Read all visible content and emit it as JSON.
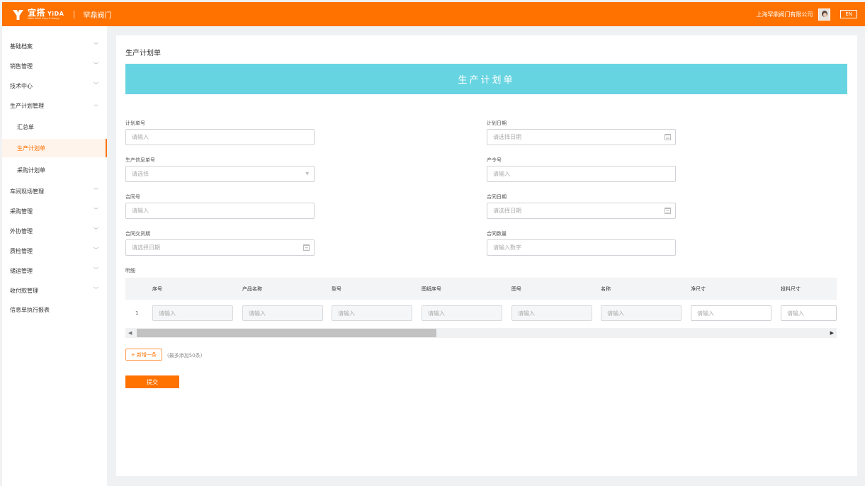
{
  "header": {
    "logo_text": "宜搭",
    "logo_en": "YiDA",
    "logo_tagline": "Make Work Easy & Happy",
    "org_name": "罕鼎阀门",
    "company": "上海罕鼎阀门有限公司",
    "lang_button": "EN"
  },
  "colors": {
    "brand": "#ff7200",
    "banner": "#67d4e1"
  },
  "sidebar": {
    "items": [
      {
        "label": "基础档案",
        "expanded": false
      },
      {
        "label": "销售管理",
        "expanded": false
      },
      {
        "label": "技术中心",
        "expanded": false
      },
      {
        "label": "生产计划管理",
        "expanded": true
      },
      {
        "label": "汇总单",
        "child": true
      },
      {
        "label": "生产计划单",
        "child": true,
        "active": true
      },
      {
        "label": "采购计划单",
        "child": true
      },
      {
        "label": "车间现场管理",
        "expanded": false
      },
      {
        "label": "采购管理",
        "expanded": false
      },
      {
        "label": "外协管理",
        "expanded": false
      },
      {
        "label": "质检管理",
        "expanded": false
      },
      {
        "label": "储运管理",
        "expanded": false
      },
      {
        "label": "收付款管理",
        "expanded": false
      },
      {
        "label": "信息单执行报表"
      }
    ]
  },
  "main": {
    "page_title": "生产计划单",
    "banner_title": "生产计划单",
    "fields": [
      {
        "label": "计划单号",
        "placeholder": "请输入",
        "type": "text"
      },
      {
        "label": "计划日期",
        "placeholder": "请选择日期",
        "type": "date"
      },
      {
        "label": "生产信息单号",
        "placeholder": "请选择",
        "type": "select"
      },
      {
        "label": "产令号",
        "placeholder": "请输入",
        "type": "text"
      },
      {
        "label": "合同号",
        "placeholder": "请输入",
        "type": "text"
      },
      {
        "label": "合同日期",
        "placeholder": "请选择日期",
        "type": "date"
      },
      {
        "label": "合同交货期",
        "placeholder": "请选择日期",
        "type": "date"
      },
      {
        "label": "合同数量",
        "placeholder": "请输入数字",
        "type": "number"
      }
    ],
    "detail": {
      "label": "明细",
      "columns": [
        "序号",
        "产品名称",
        "型号",
        "图纸序号",
        "图号",
        "名称",
        "净尺寸",
        "投料尺寸"
      ],
      "rows": [
        {
          "index": "1",
          "cells": [
            "请输入",
            "请输入",
            "请输入",
            "请输入",
            "请输入",
            "请输入",
            "请输入",
            "请输入"
          ]
        }
      ]
    },
    "add_button": "+ 新增一条",
    "add_note": "(最多添加50条)",
    "submit_button": "提交"
  }
}
